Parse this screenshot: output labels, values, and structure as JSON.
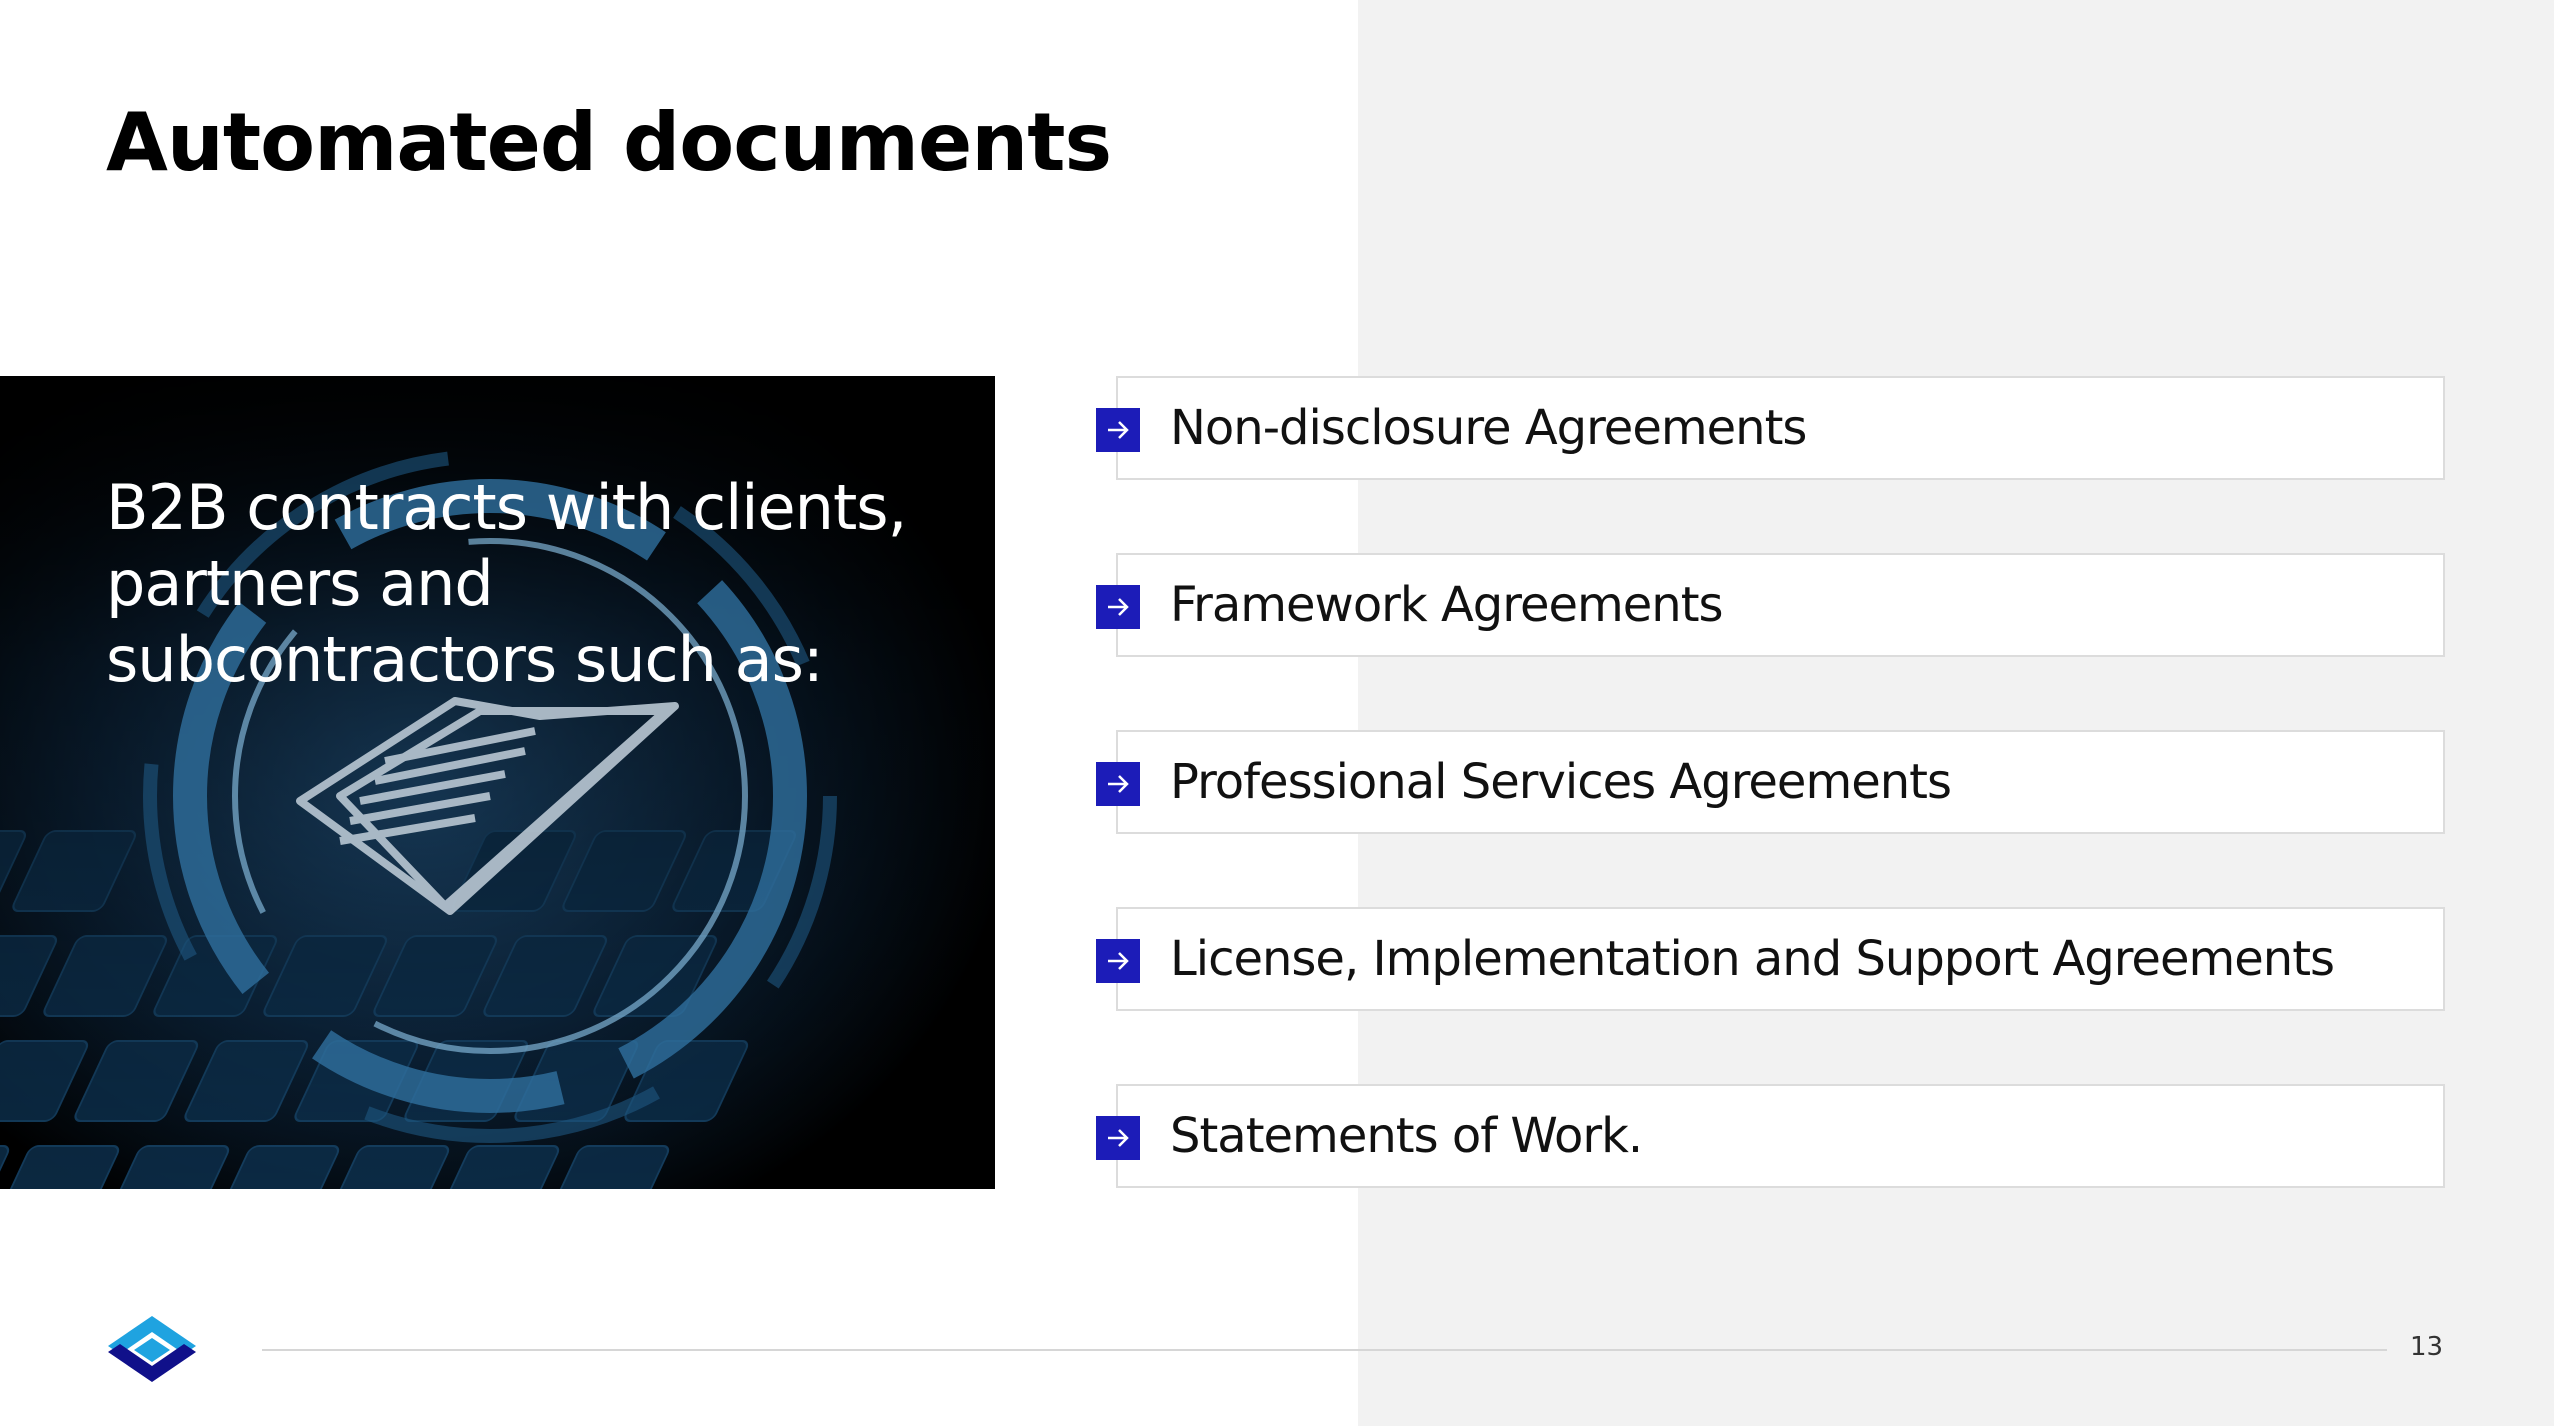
{
  "slide": {
    "title": "Automated documents",
    "hero_text": "B2B contracts with clients, partners and subcontractors such as:",
    "page_number": "13"
  },
  "items": [
    {
      "label": "Non-disclosure Agreements"
    },
    {
      "label": "Framework Agreements"
    },
    {
      "label": "Professional Services Agreements"
    },
    {
      "label": "License, Implementation and Support Agreements"
    },
    {
      "label": "Statements of Work."
    }
  ],
  "icons": {
    "item_marker": "arrow-right-icon",
    "logo": "brand-logo-icon",
    "hero_illustration": "document-icon"
  },
  "colors": {
    "accent_blue": "#1c1cb8",
    "right_panel_bg": "#f2f2f2",
    "hero_bg": "#000000"
  }
}
